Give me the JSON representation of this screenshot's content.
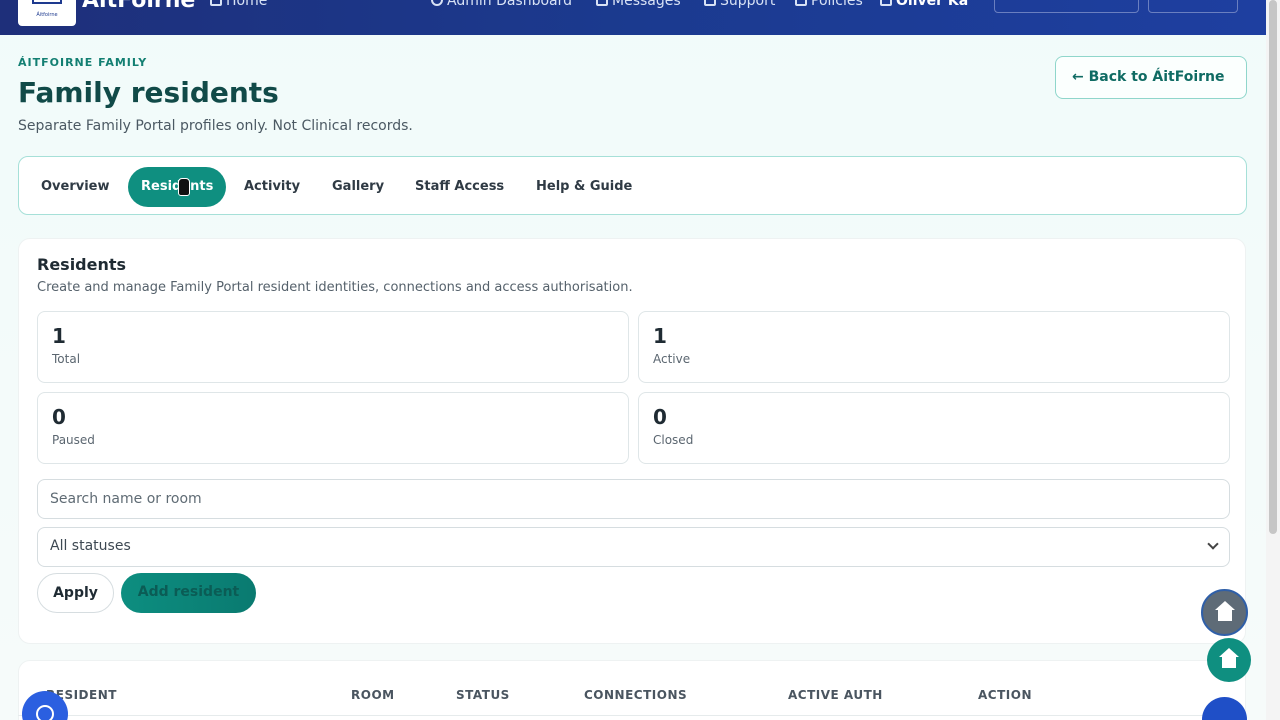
{
  "topbar": {
    "brand": "ÁitFoirne",
    "logo_caption": "Áitfoirne",
    "home": "Home",
    "admin_dashboard": "Admin Dashboard",
    "messages": "Messages",
    "support": "Support",
    "policies": "Policies",
    "user": "Oliver Ka"
  },
  "header": {
    "eyebrow": "ÁITFOIRNE FAMILY",
    "title": "Family residents",
    "subtitle": "Separate Family Portal profiles only. Not Clinical records.",
    "back_label": "Back to ÁitFoirne",
    "back_arrow": "←"
  },
  "tabs": [
    {
      "label": "Overview"
    },
    {
      "label": "Residents",
      "active": true
    },
    {
      "label": "Activity"
    },
    {
      "label": "Gallery"
    },
    {
      "label": "Staff Access"
    },
    {
      "label": "Help & Guide"
    }
  ],
  "residents": {
    "title": "Residents",
    "description": "Create and manage Family Portal resident identities, connections and access authorisation.",
    "stats": [
      {
        "value": "1",
        "label": "Total"
      },
      {
        "value": "1",
        "label": "Active"
      },
      {
        "value": "0",
        "label": "Paused"
      },
      {
        "value": "0",
        "label": "Closed"
      }
    ],
    "search_placeholder": "Search name or room",
    "status_selected": "All statuses",
    "apply_label": "Apply",
    "add_label": "Add resident"
  },
  "table": {
    "columns": [
      "RESIDENT",
      "ROOM",
      "STATUS",
      "CONNECTIONS",
      "ACTIVE AUTH",
      "ACTION"
    ]
  },
  "colors": {
    "accent": "#0f8f80",
    "nav": "#1e3a8f",
    "title": "#114a48"
  },
  "icons": {
    "home_fab": "home-icon",
    "chat_fab": "chat-icon",
    "back_fab": "arrow-left-icon"
  }
}
